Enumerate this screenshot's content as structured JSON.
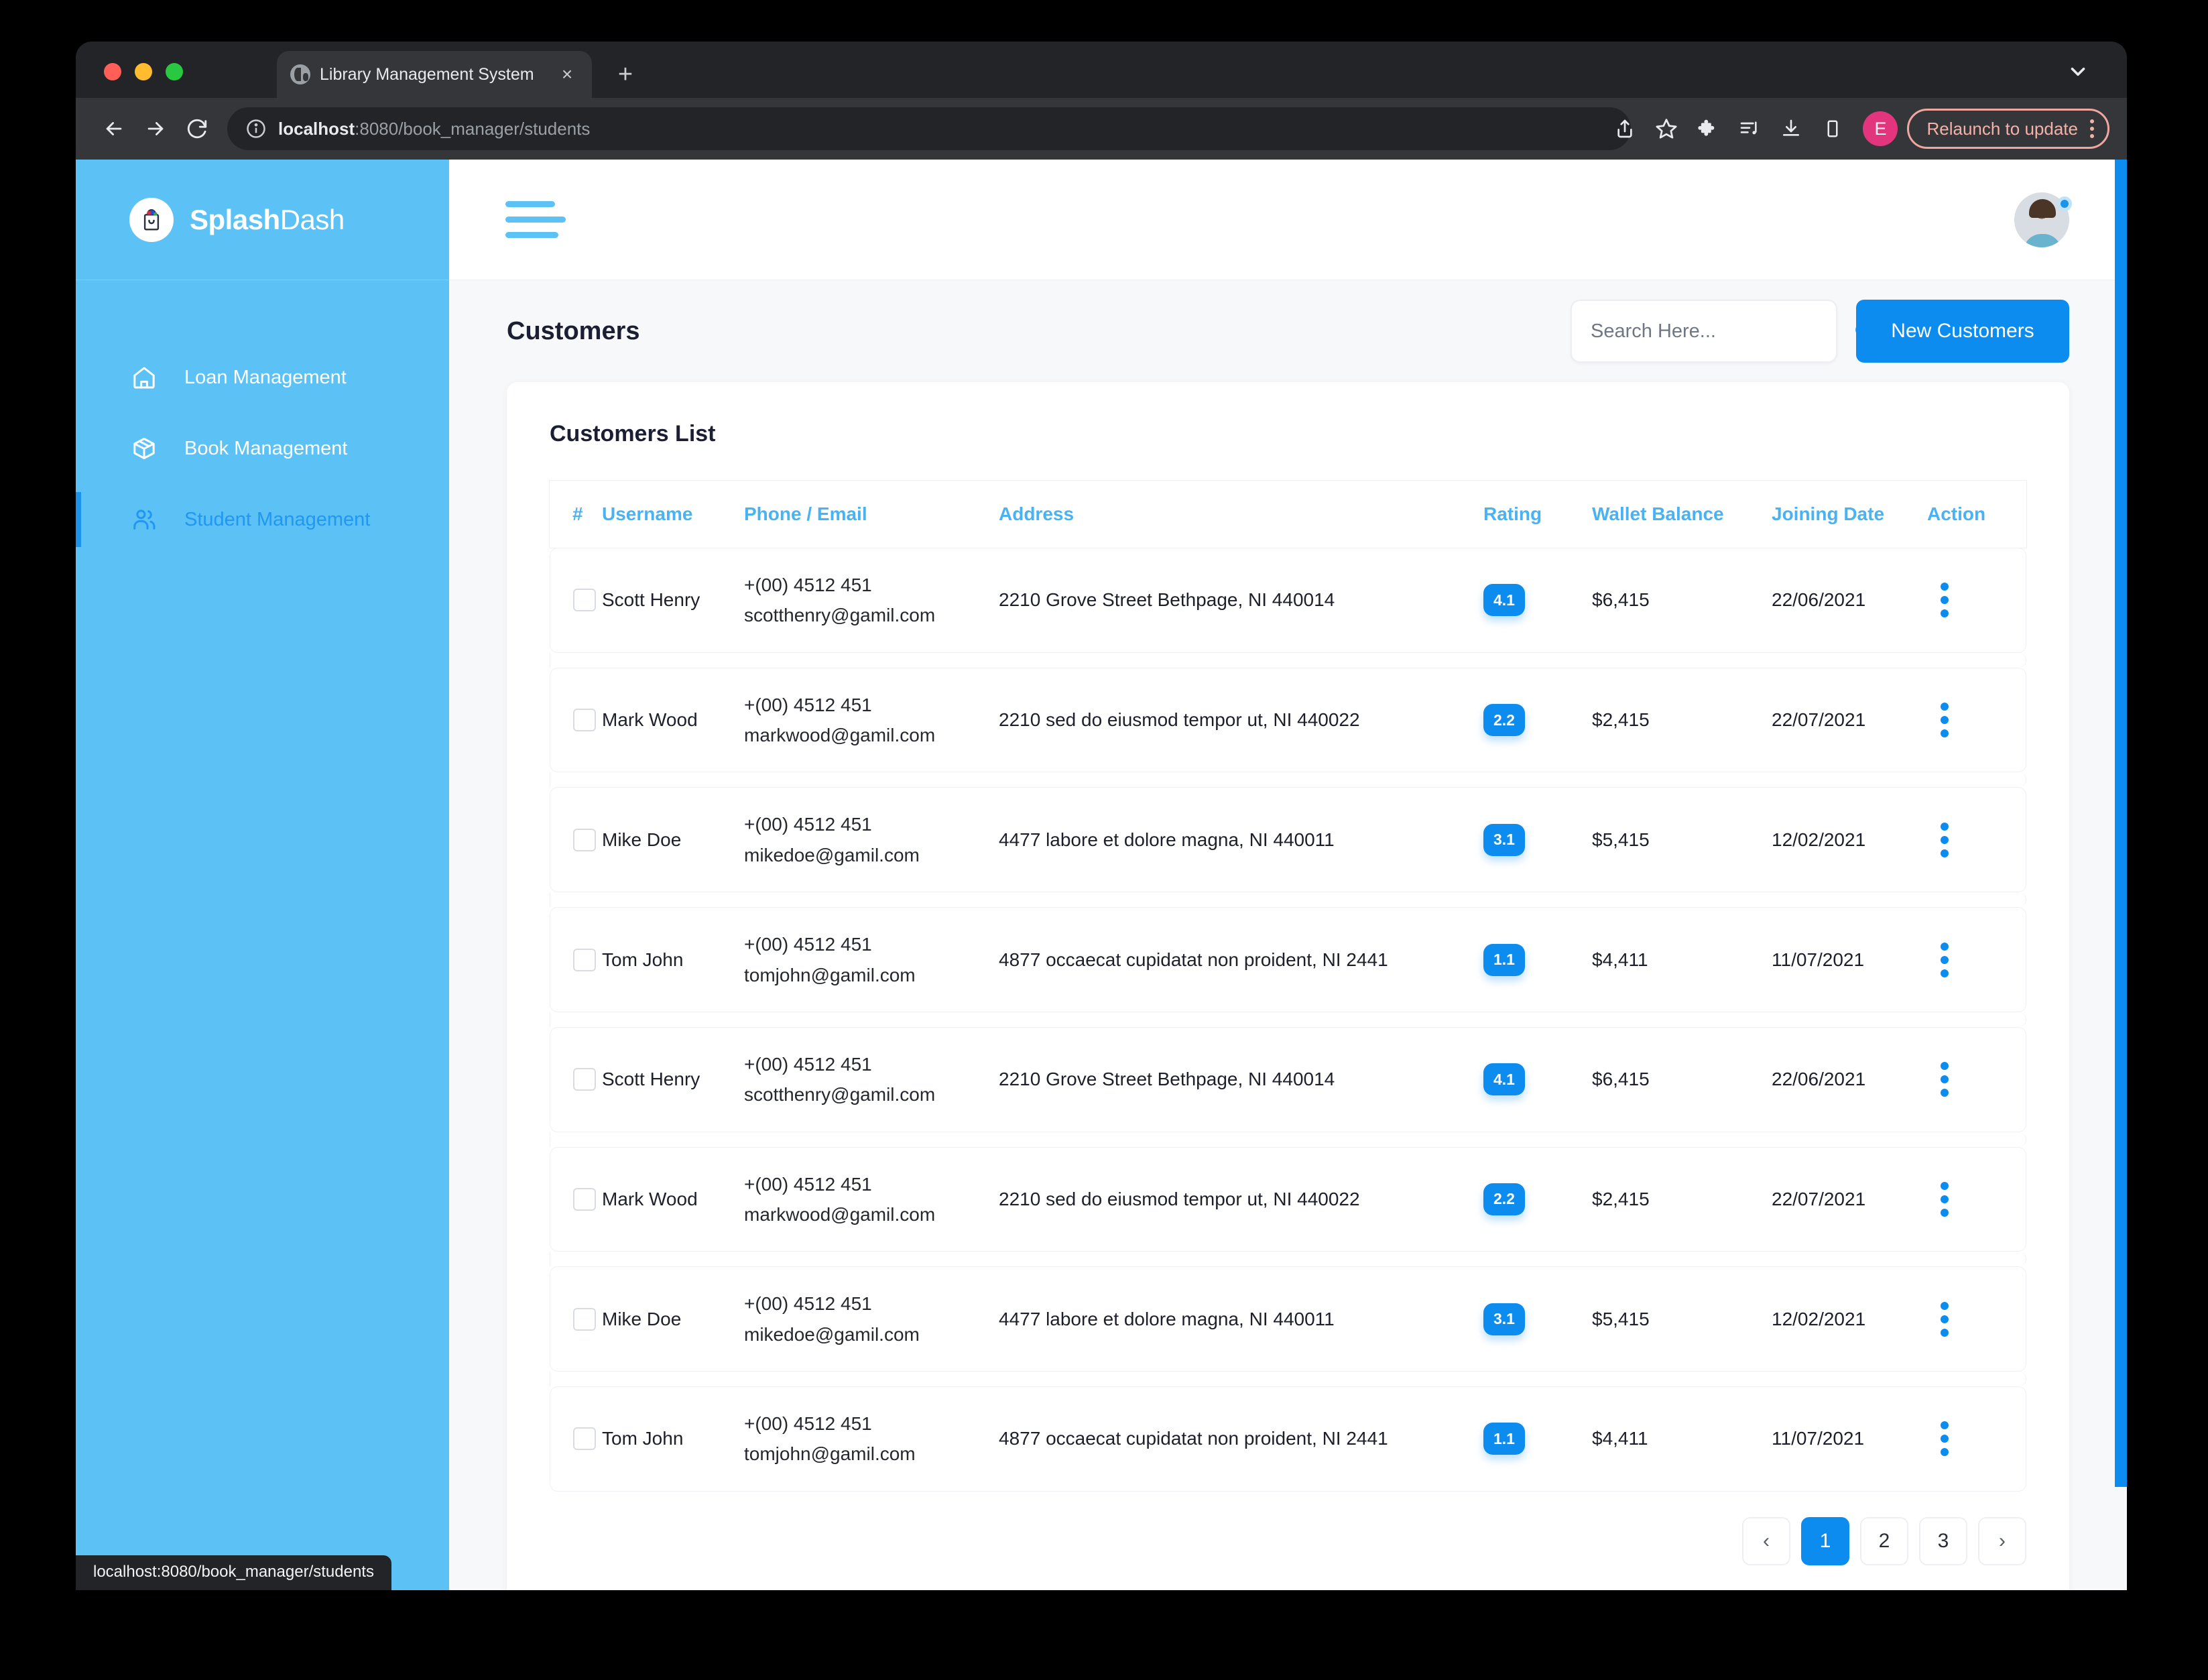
{
  "browser": {
    "tab": {
      "title": "Library Management System",
      "favicon": "globe-icon",
      "close": "×"
    },
    "new_tab": "+",
    "omnibox": {
      "url_host": "localhost",
      "url_path": ":8080/book_manager/students"
    },
    "relaunch_label": "Relaunch to update",
    "profile_initial": "E",
    "status_bubble": "localhost:8080/book_manager/students"
  },
  "sidebar": {
    "brand": {
      "name_bold": "Splash",
      "name_light": "Dash",
      "logo": "shopping-bag-icon"
    },
    "items": [
      {
        "label": "Loan Management",
        "icon": "home-icon",
        "active": false
      },
      {
        "label": "Book Management",
        "icon": "box-icon",
        "active": false
      },
      {
        "label": "Student Management",
        "icon": "users-icon",
        "active": true
      }
    ]
  },
  "topbar": {
    "menu_toggle": "hamburger-icon",
    "avatar": "user-avatar"
  },
  "page": {
    "title": "Customers",
    "search": {
      "placeholder": "Search Here...",
      "value": ""
    },
    "new_button": "New Customers",
    "card_title": "Customers List"
  },
  "table": {
    "columns": [
      "#",
      "Username",
      "Phone / Email",
      "Address",
      "Rating",
      "Wallet Balance",
      "Joining Date",
      "Action"
    ],
    "rows": [
      {
        "username": "Scott Henry",
        "phone": "+(00) 4512 451",
        "email": "scotthenry@gamil.com",
        "address": "2210 Grove Street Bethpage, NI 440014",
        "rating": "4.1",
        "wallet": "$6,415",
        "joining_date": "22/06/2021"
      },
      {
        "username": "Mark Wood",
        "phone": "+(00) 4512 451",
        "email": "markwood@gamil.com",
        "address": "2210 sed do eiusmod tempor ut, NI 440022",
        "rating": "2.2",
        "wallet": "$2,415",
        "joining_date": "22/07/2021"
      },
      {
        "username": "Mike Doe",
        "phone": "+(00) 4512 451",
        "email": "mikedoe@gamil.com",
        "address": "4477 labore et dolore magna, NI 440011",
        "rating": "3.1",
        "wallet": "$5,415",
        "joining_date": "12/02/2021"
      },
      {
        "username": "Tom John",
        "phone": "+(00) 4512 451",
        "email": "tomjohn@gamil.com",
        "address": "4877 occaecat cupidatat non proident, NI 2441",
        "rating": "1.1",
        "wallet": "$4,411",
        "joining_date": "11/07/2021"
      },
      {
        "username": "Scott Henry",
        "phone": "+(00) 4512 451",
        "email": "scotthenry@gamil.com",
        "address": "2210 Grove Street Bethpage, NI 440014",
        "rating": "4.1",
        "wallet": "$6,415",
        "joining_date": "22/06/2021"
      },
      {
        "username": "Mark Wood",
        "phone": "+(00) 4512 451",
        "email": "markwood@gamil.com",
        "address": "2210 sed do eiusmod tempor ut, NI 440022",
        "rating": "2.2",
        "wallet": "$2,415",
        "joining_date": "22/07/2021"
      },
      {
        "username": "Mike Doe",
        "phone": "+(00) 4512 451",
        "email": "mikedoe@gamil.com",
        "address": "4477 labore et dolore magna, NI 440011",
        "rating": "3.1",
        "wallet": "$5,415",
        "joining_date": "12/02/2021"
      },
      {
        "username": "Tom John",
        "phone": "+(00) 4512 451",
        "email": "tomjohn@gamil.com",
        "address": "4877 occaecat cupidatat non proident, NI 2441",
        "rating": "1.1",
        "wallet": "$4,411",
        "joining_date": "11/07/2021"
      }
    ]
  },
  "pagination": {
    "prev": "‹",
    "next": "›",
    "pages": [
      "1",
      "2",
      "3"
    ],
    "current": "1"
  },
  "colors": {
    "brand_blue": "#5cc1f5",
    "accent_blue": "#0d8cf0",
    "header_blue": "#49b2f2",
    "update_pink": "#f3b1a8"
  }
}
